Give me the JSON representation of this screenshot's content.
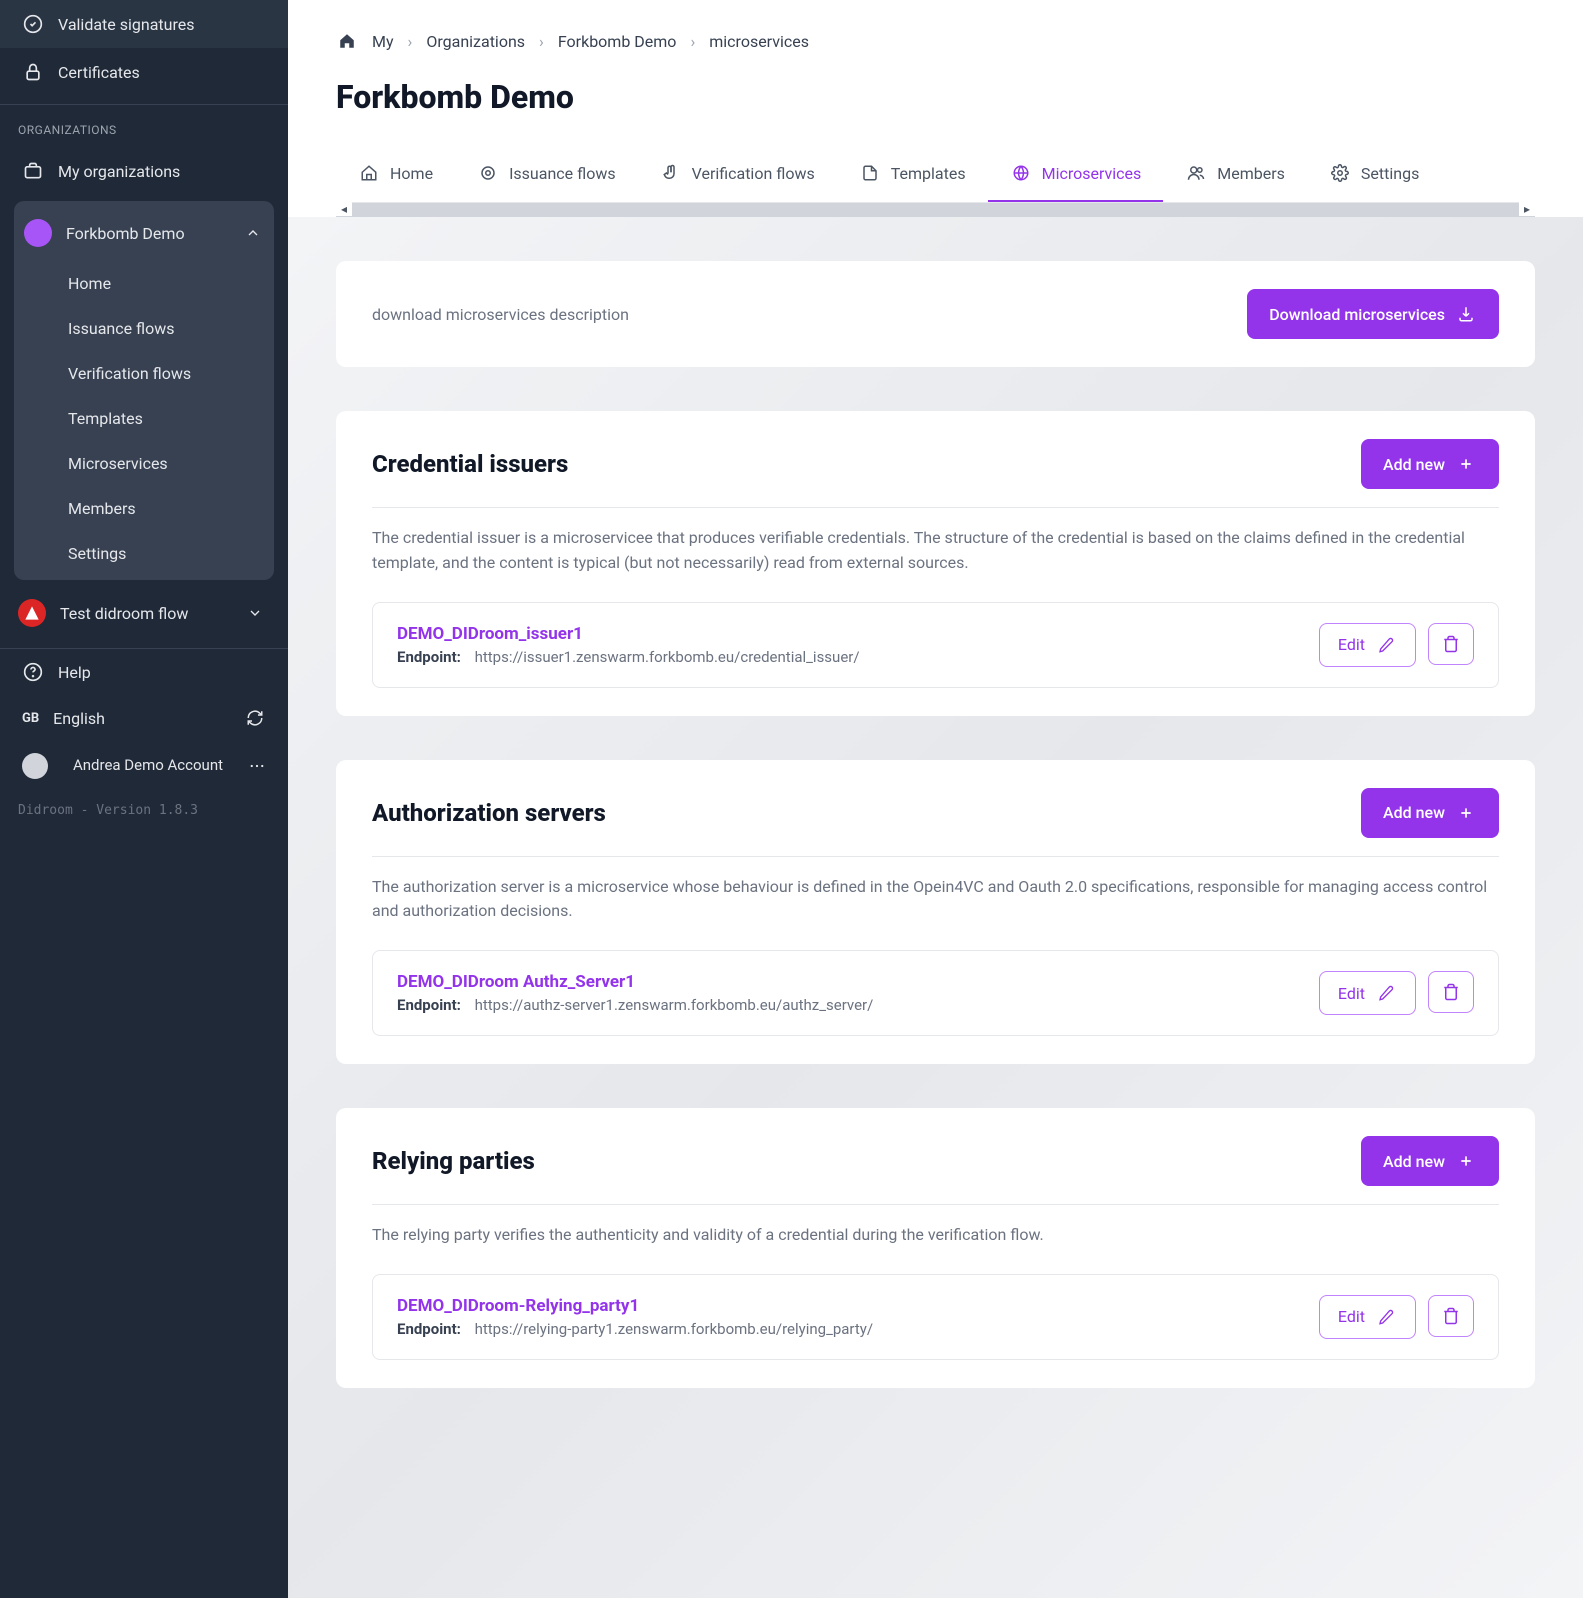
{
  "sidebar": {
    "top_items": [
      {
        "label": "Validate signatures",
        "icon": "check-circle"
      },
      {
        "label": "Certificates",
        "icon": "lock"
      }
    ],
    "org_header": "Organizations",
    "my_orgs": "My organizations",
    "active_org": "Forkbomb Demo",
    "sub_items": [
      "Home",
      "Issuance flows",
      "Verification flows",
      "Templates",
      "Microservices",
      "Members",
      "Settings"
    ],
    "other_org": "Test didroom flow",
    "help": "Help",
    "lang_code": "GB",
    "lang_label": "English",
    "user_name": "Andrea Demo Account",
    "version": "Didroom - Version 1.8.3"
  },
  "breadcrumb": [
    "My",
    "Organizations",
    "Forkbomb Demo",
    "microservices"
  ],
  "page_title": "Forkbomb Demo",
  "tabs": [
    {
      "label": "Home",
      "icon": "home"
    },
    {
      "label": "Issuance flows",
      "icon": "target"
    },
    {
      "label": "Verification flows",
      "icon": "hand"
    },
    {
      "label": "Templates",
      "icon": "file"
    },
    {
      "label": "Microservices",
      "icon": "globe",
      "active": true
    },
    {
      "label": "Members",
      "icon": "users"
    },
    {
      "label": "Settings",
      "icon": "gear"
    }
  ],
  "download": {
    "text": "download microservices description",
    "button": "Download microservices"
  },
  "sections": [
    {
      "title": "Credential issuers",
      "add_label": "Add new",
      "desc": "The credential issuer is a microservicee that produces verifiable credentials. The structure of the credential is based on the claims defined in the credential template, and the content is typical (but not necessarily) read from external sources.",
      "item_name": "DEMO_DIDroom_issuer1",
      "endpoint_label": "Endpoint:",
      "endpoint_value": "https://issuer1.zenswarm.forkbomb.eu/credential_issuer/",
      "edit_label": "Edit"
    },
    {
      "title": "Authorization servers",
      "add_label": "Add new",
      "desc": "The authorization server is a microservice whose behaviour is defined in the Opein4VC and Oauth 2.0 specifications, responsible for managing access control and authorization decisions.",
      "item_name": "DEMO_DIDroom Authz_Server1",
      "endpoint_label": "Endpoint:",
      "endpoint_value": "https://authz-server1.zenswarm.forkbomb.eu/authz_server/",
      "edit_label": "Edit"
    },
    {
      "title": "Relying parties",
      "add_label": "Add new",
      "desc": "The relying party verifies the authenticity and validity of a credential during the verification flow.",
      "item_name": "DEMO_DIDroom-Relying_party1",
      "endpoint_label": "Endpoint:",
      "endpoint_value": "https://relying-party1.zenswarm.forkbomb.eu/relying_party/",
      "edit_label": "Edit"
    }
  ]
}
